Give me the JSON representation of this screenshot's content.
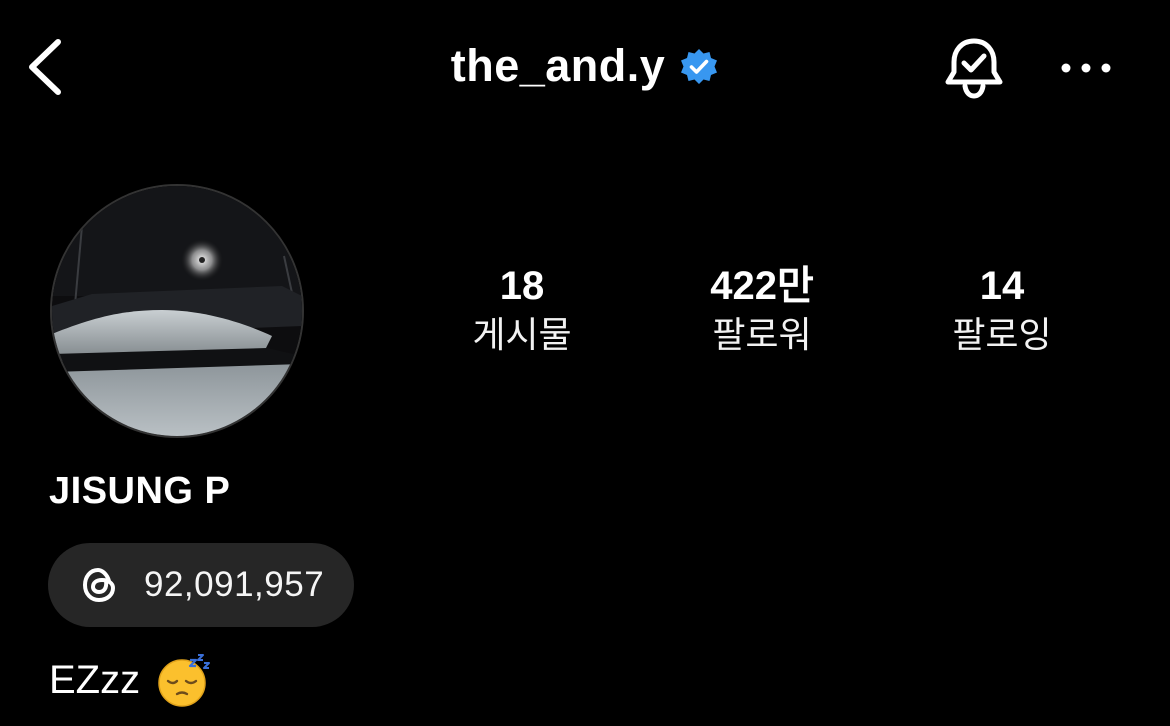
{
  "header": {
    "username": "the_and.y",
    "verified_icon": "verified-badge-icon",
    "back_icon": "chevron-left-icon",
    "notify_icon": "bell-check-icon",
    "more_icon": "more-horizontal-icon"
  },
  "profile": {
    "full_name": "JISUNG P",
    "threads": {
      "icon": "threads-icon",
      "count": "92,091,957"
    },
    "bio": {
      "text": "EZzz",
      "emoji": "sleeping-face-emoji"
    }
  },
  "stats": [
    {
      "value": "18",
      "label": "게시물"
    },
    {
      "value": "422만",
      "label": "팔로워"
    },
    {
      "value": "14",
      "label": "팔로잉"
    }
  ],
  "colors": {
    "background": "#000000",
    "text": "#ffffff",
    "verified": "#3897f0",
    "chip": "#262626"
  }
}
